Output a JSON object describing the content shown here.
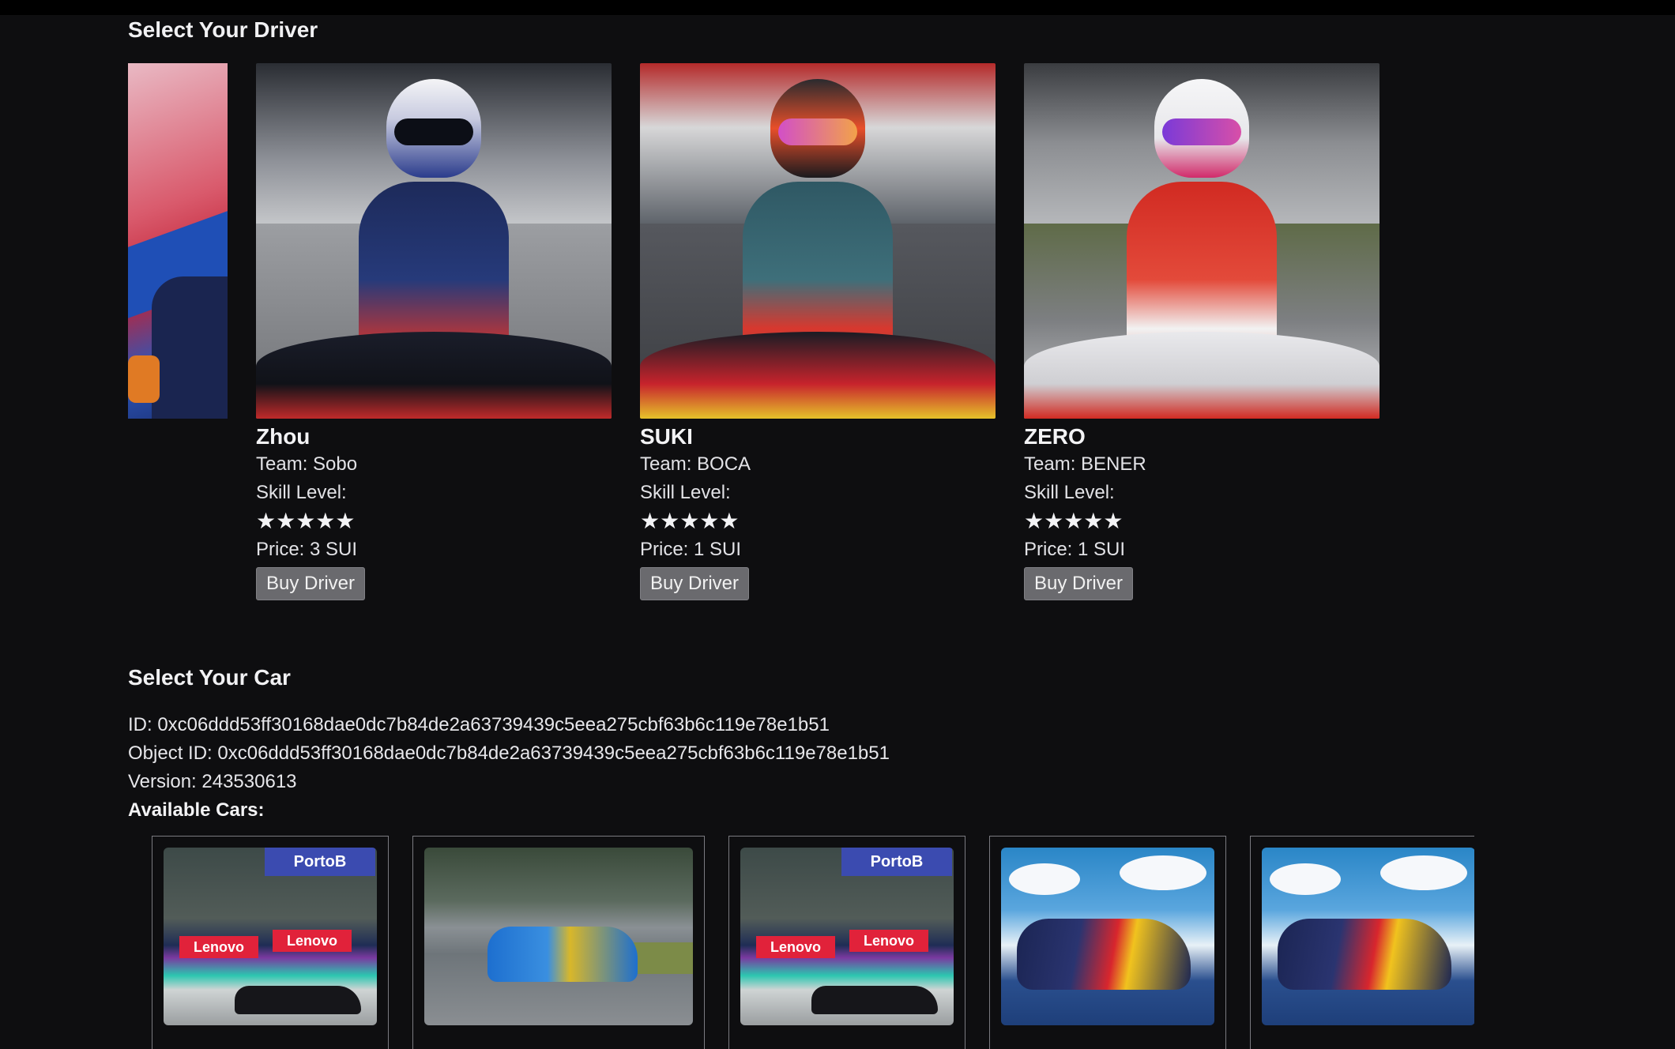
{
  "drivers_section": {
    "title": "Select Your Driver",
    "drivers": [
      {
        "name": "Zhou",
        "team": "Team: Sobo",
        "skill_label": "Skill Level:",
        "stars": "★★★★★",
        "price": "Price: 3 SUI",
        "button": "Buy Driver"
      },
      {
        "name": "SUKI",
        "team": "Team: BOCA",
        "skill_label": "Skill Level:",
        "stars": "★★★★★",
        "price": "Price: 1 SUI",
        "button": "Buy Driver"
      },
      {
        "name": "ZERO",
        "team": "Team: BENER",
        "skill_label": "Skill Level:",
        "stars": "★★★★★",
        "price": "Price: 1 SUI",
        "button": "Buy Driver"
      }
    ]
  },
  "cars_section": {
    "title": "Select Your Car",
    "id_line": "ID: 0xc06ddd53ff30168dae0dc7b84de2a63739439c5eea275cbf63b6c119e78e1b51",
    "object_id_line": "Object ID: 0xc06ddd53ff30168dae0dc7b84de2a63739439c5eea275cbf63b6c119e78e1b51",
    "version_line": "Version: 243530613",
    "available_label": "Available Cars:",
    "thumb_text": {
      "lenovo": "Lenovo",
      "porto": "PortoB"
    }
  }
}
